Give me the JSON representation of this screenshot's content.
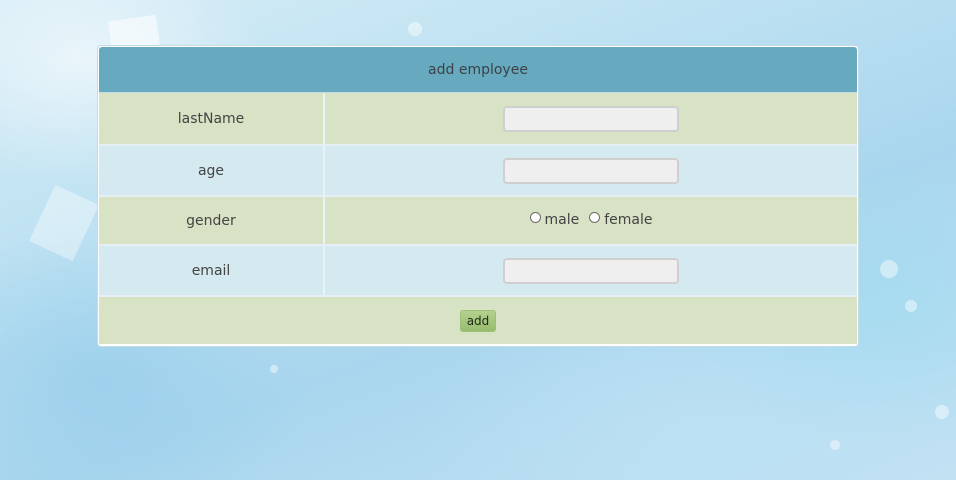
{
  "form": {
    "title": "add employee",
    "fields": {
      "lastName": {
        "label": "lastName",
        "value": "",
        "placeholder": ""
      },
      "age": {
        "label": "age",
        "value": "",
        "placeholder": ""
      },
      "gender": {
        "label": "gender",
        "options": [
          {
            "label": "male",
            "selected": false
          },
          {
            "label": "female",
            "selected": false
          }
        ]
      },
      "email": {
        "label": "email",
        "value": "",
        "placeholder": ""
      }
    },
    "submit_label": "add"
  },
  "colors": {
    "header_bg": "#67a9be",
    "row_green": "#d8e2c5",
    "row_blue": "#d5e9f1",
    "button_green": "#a6c77f"
  }
}
